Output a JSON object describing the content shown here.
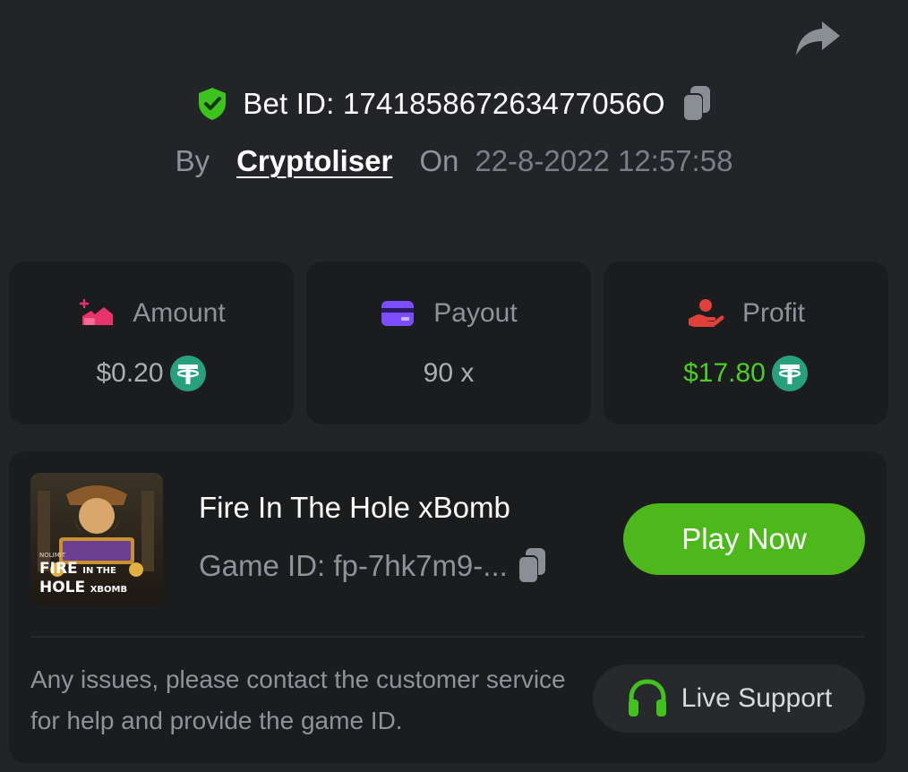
{
  "header": {
    "share_icon": "share-arrow-icon",
    "bet_id": "Bet ID: 174185867263477056O",
    "verified_icon": "shield-check-icon",
    "copy_icon": "copy-icon",
    "by_label": "By",
    "username": "Cryptoliser",
    "on_label": "On",
    "date": "22-8-2022 12:57:58"
  },
  "stats": [
    {
      "label": "Amount",
      "value": "$0.20",
      "icon": "amount-icon",
      "currency_icon": "tether-icon",
      "color": "#e8336d"
    },
    {
      "label": "Payout",
      "value": "90 x",
      "icon": "card-icon",
      "color": "#7b4dff"
    },
    {
      "label": "Profit",
      "value": "$17.80",
      "icon": "profit-hand-icon",
      "currency_icon": "tether-icon",
      "color": "#e0403a"
    }
  ],
  "game": {
    "thumb_line1": "FIRE",
    "thumb_line1_small": "IN THE",
    "thumb_line2": "HOLE",
    "thumb_line2_small": "XBOMB",
    "thumb_brand": "NOLIMIT",
    "name": "Fire In The Hole xBomb",
    "game_id": "Game ID: fp-7hk7m9-...",
    "play_label": "Play Now"
  },
  "support": {
    "notice": "Any issues, please contact the customer service for help and provide the game ID.",
    "button_label": "Live Support",
    "icon": "headset-icon"
  },
  "colors": {
    "background": "#232427",
    "card": "#1b1c1e",
    "accent_green": "#4db81c",
    "profit_green": "#4ccd2a",
    "tether": "#27a17c"
  }
}
